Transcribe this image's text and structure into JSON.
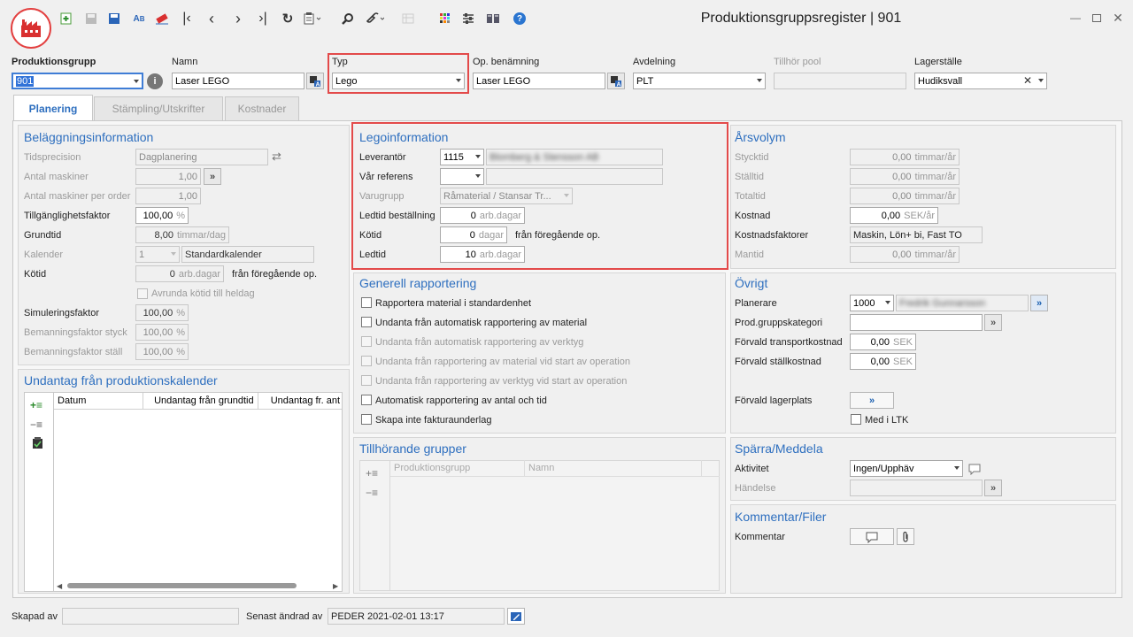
{
  "window": {
    "title": "Produktionsgruppsregister | 901"
  },
  "header": {
    "produktionsgrupp": {
      "label": "Produktionsgrupp",
      "value": "901"
    },
    "namn": {
      "label": "Namn",
      "value": "Laser LEGO"
    },
    "typ": {
      "label": "Typ",
      "value": "Lego"
    },
    "op_benamning": {
      "label": "Op. benämning",
      "value": "Laser LEGO"
    },
    "avdelning": {
      "label": "Avdelning",
      "value": "PLT"
    },
    "tillhor_pool": {
      "label": "Tillhör pool",
      "value": ""
    },
    "lagerstalle": {
      "label": "Lagerställe",
      "value": "Hudiksvall"
    }
  },
  "tabs": [
    {
      "label": "Planering"
    },
    {
      "label": "Stämpling/Utskrifter"
    },
    {
      "label": "Kostnader"
    }
  ],
  "belaggning": {
    "title": "Beläggningsinformation",
    "tidsprecision": {
      "label": "Tidsprecision",
      "value": "Dagplanering"
    },
    "antal_maskiner": {
      "label": "Antal maskiner",
      "value": "1,00"
    },
    "antal_maskiner_order": {
      "label": "Antal maskiner per order",
      "value": "1,00"
    },
    "tillganglighet": {
      "label": "Tillgänglighetsfaktor",
      "value": "100,00",
      "unit": "%"
    },
    "grundtid": {
      "label": "Grundtid",
      "value": "8,00",
      "unit": "timmar/dag"
    },
    "kalender": {
      "label": "Kalender",
      "value": "1",
      "name": "Standardkalender"
    },
    "kotid": {
      "label": "Kötid",
      "value": "0",
      "unit": "arb.dagar",
      "suffix": "från föregående op."
    },
    "avrunda": {
      "label": "Avrunda kötid till heldag"
    },
    "simulering": {
      "label": "Simuleringsfaktor",
      "value": "100,00",
      "unit": "%"
    },
    "bem_styck": {
      "label": "Bemanningsfaktor styck",
      "value": "100,00",
      "unit": "%"
    },
    "bem_stall": {
      "label": "Bemanningsfaktor ställ",
      "value": "100,00",
      "unit": "%"
    }
  },
  "undantag": {
    "title": "Undantag från produktionskalender",
    "columns": [
      "Datum",
      "Undantag från grundtid",
      "Undantag fr. ant"
    ]
  },
  "lego": {
    "title": "Legoinformation",
    "leverantor": {
      "label": "Leverantör",
      "code": "1115",
      "name": "Blomberg & Stensson AB"
    },
    "var_referens": {
      "label": "Vår referens",
      "value": ""
    },
    "varugrupp": {
      "label": "Varugrupp",
      "value": "Råmaterial / Stansar Tr..."
    },
    "ledtid_best": {
      "label": "Ledtid beställning",
      "value": "0",
      "unit": "arb.dagar"
    },
    "kotid": {
      "label": "Kötid",
      "value": "0",
      "unit": "dagar",
      "suffix": "från föregående op."
    },
    "ledtid": {
      "label": "Ledtid",
      "value": "10",
      "unit": "arb.dagar"
    }
  },
  "rapportering": {
    "title": "Generell rapportering",
    "items": [
      {
        "label": "Rapportera material i standardenhet",
        "enabled": true
      },
      {
        "label": "Undanta från automatisk rapportering av material",
        "enabled": true
      },
      {
        "label": "Undanta från automatisk rapportering av verktyg",
        "enabled": false
      },
      {
        "label": "Undanta från rapportering av material vid start av operation",
        "enabled": false
      },
      {
        "label": "Undanta från rapportering av verktyg vid start av operation",
        "enabled": false
      },
      {
        "label": "Automatisk rapportering av antal och tid",
        "enabled": true
      },
      {
        "label": "Skapa inte fakturaunderlag",
        "enabled": true
      }
    ]
  },
  "tillhorande": {
    "title": "Tillhörande grupper",
    "columns": [
      "Produktionsgrupp",
      "Namn"
    ]
  },
  "arsvolym": {
    "title": "Årsvolym",
    "stycktid": {
      "label": "Stycktid",
      "value": "0,00",
      "unit": "timmar/år"
    },
    "stalltid": {
      "label": "Ställtid",
      "value": "0,00",
      "unit": "timmar/år"
    },
    "totaltid": {
      "label": "Totaltid",
      "value": "0,00",
      "unit": "timmar/år"
    },
    "kostnad": {
      "label": "Kostnad",
      "value": "0,00",
      "unit": "SEK/år"
    },
    "kostnadsfaktorer": {
      "label": "Kostnadsfaktorer",
      "value": "Maskin, Lön+ bi, Fast TO"
    },
    "mantid": {
      "label": "Mantid",
      "value": "0,00",
      "unit": "timmar/år"
    }
  },
  "ovrigt": {
    "title": "Övrigt",
    "planerare": {
      "label": "Planerare",
      "code": "1000",
      "name": "Fredrik Gunnarsson"
    },
    "kategori": {
      "label": "Prod.gruppskategori",
      "value": ""
    },
    "transport": {
      "label": "Förvald transportkostnad",
      "value": "0,00",
      "unit": "SEK"
    },
    "stall": {
      "label": "Förvald ställkostnad",
      "value": "0,00",
      "unit": "SEK"
    },
    "lagerplats": {
      "label": "Förvald lagerplats"
    },
    "med_ltk": {
      "label": "Med i LTK"
    }
  },
  "sparra": {
    "title": "Spärra/Meddela",
    "aktivitet": {
      "label": "Aktivitet",
      "value": "Ingen/Upphäv"
    },
    "handelse": {
      "label": "Händelse",
      "value": ""
    }
  },
  "kommentar": {
    "title": "Kommentar/Filer",
    "label": "Kommentar"
  },
  "footer": {
    "skapad_label": "Skapad av",
    "skapad_value": "",
    "andrad_label": "Senast ändrad av",
    "andrad_value": "PEDER 2021-02-01 13:17"
  }
}
